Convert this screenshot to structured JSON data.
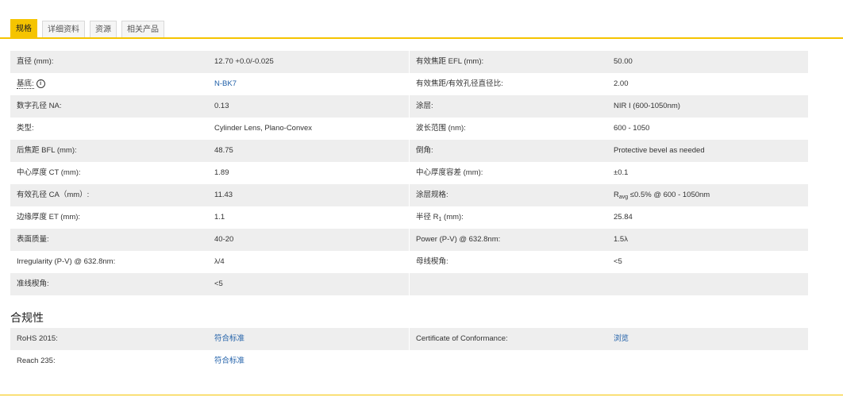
{
  "tabs": [
    {
      "label": "规格",
      "active": true
    },
    {
      "label": "详细资料",
      "active": false
    },
    {
      "label": "资源",
      "active": false
    },
    {
      "label": "相关产品",
      "active": false
    }
  ],
  "specs": {
    "rows": [
      {
        "l1": "直径 (mm):",
        "v1": "12.70 +0.0/-0.025",
        "l2": "有效焦距 EFL (mm):",
        "v2": "50.00"
      },
      {
        "l1": "基底:",
        "v1": "N-BK7",
        "l2": "有效焦距/有效孔径直径比:",
        "v2": "2.00"
      },
      {
        "l1": "数字孔径 NA:",
        "v1": "0.13",
        "l2": "涂层:",
        "v2": "NIR I (600-1050nm)"
      },
      {
        "l1": "类型:",
        "v1": "Cylinder Lens, Plano-Convex",
        "l2": "波长范围 (nm):",
        "v2": "600 - 1050"
      },
      {
        "l1": "后焦距 BFL (mm):",
        "v1": "48.75",
        "l2": "倒角:",
        "v2": "Protective bevel as needed"
      },
      {
        "l1": "中心厚度 CT (mm):",
        "v1": "1.89",
        "l2": "中心厚度容差 (mm):",
        "v2": "±0.1"
      },
      {
        "l1": "有效孔径 CA（mm）:",
        "v1": "11.43",
        "l2": "涂层规格:",
        "v2_main": "R",
        "v2_sub": "avg",
        "v2_rest": " ≤0.5% @ 600 - 1050nm"
      },
      {
        "l1": "边缘厚度 ET (mm):",
        "v1": "1.1",
        "l2_main": "半径 R",
        "l2_sub": "1",
        "l2_rest": " (mm):",
        "v2": "25.84"
      },
      {
        "l1": "表面质量:",
        "v1": "40-20",
        "l2": "Power (P-V) @ 632.8nm:",
        "v2": "1.5λ"
      },
      {
        "l1": "Irregularity (P-V) @ 632.8nm:",
        "v1": "λ/4",
        "l2": "母线楔角:",
        "v2": "<5"
      },
      {
        "l1": "准线楔角:",
        "v1": "<5",
        "l2": "",
        "v2": ""
      }
    ]
  },
  "compliance": {
    "heading": "合规性",
    "rows": [
      {
        "l1": "RoHS 2015:",
        "v1": "符合标准",
        "l2": "Certificate of Conformance:",
        "v2": "浏览"
      },
      {
        "l1": "Reach 235:",
        "v1": "符合标准",
        "l2": "",
        "v2": ""
      }
    ]
  },
  "colors": {
    "accent": "#f5c400",
    "link": "#1f5fa8",
    "row_shade": "#eeeeee"
  },
  "icons": {
    "substrate_info": "info-icon"
  }
}
